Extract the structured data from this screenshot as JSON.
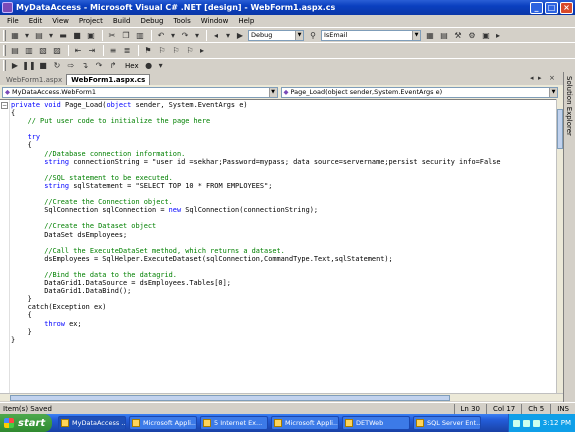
{
  "window": {
    "title": "MyDataAccess - Microsoft Visual C# .NET [design] - WebForm1.aspx.cs"
  },
  "menu": [
    "File",
    "Edit",
    "View",
    "Project",
    "Build",
    "Debug",
    "Tools",
    "Window",
    "Help"
  ],
  "toolbar": {
    "config_value": "Debug",
    "find_value": "IsEmail",
    "hex_label": "Hex"
  },
  "tabs": [
    {
      "label": "WebForm1.aspx",
      "active": false
    },
    {
      "label": "WebForm1.aspx.cs",
      "active": true
    }
  ],
  "nav": {
    "class_combo": "MyDataAccess.WebForm1",
    "method_combo": "Page_Load(object sender,System.EventArgs e)"
  },
  "code_lines": [
    [
      [
        "kw",
        "private void "
      ],
      [
        "",
        "Page_Load("
      ],
      [
        "kw",
        "object"
      ],
      [
        "",
        " sender, System.EventArgs e)"
      ]
    ],
    [
      [
        "",
        "{"
      ]
    ],
    [
      [
        "cm",
        "    // Put user code to initialize the page here"
      ]
    ],
    [
      [
        "",
        ""
      ]
    ],
    [
      [
        "kw",
        "    try"
      ]
    ],
    [
      [
        "",
        "    {"
      ]
    ],
    [
      [
        "cm",
        "        //Database connection information."
      ]
    ],
    [
      [
        "kw",
        "        string"
      ],
      [
        "",
        " connectionString = \"user id =sekhar;Password=mypass; data source=servername;persist security info=False"
      ]
    ],
    [
      [
        "",
        ""
      ]
    ],
    [
      [
        "cm",
        "        //SQL statement to be executed."
      ]
    ],
    [
      [
        "kw",
        "        string"
      ],
      [
        "",
        " sqlStatement = \"SELECT TOP 10 * FROM EMPLOYEES\";"
      ]
    ],
    [
      [
        "",
        ""
      ]
    ],
    [
      [
        "cm",
        "        //Create the Connection object."
      ]
    ],
    [
      [
        "",
        "        SqlConnection sqlConnection = "
      ],
      [
        "kw",
        "new"
      ],
      [
        "",
        " SqlConnection(connectionString);"
      ]
    ],
    [
      [
        "",
        ""
      ]
    ],
    [
      [
        "cm",
        "        //Create the Dataset object"
      ]
    ],
    [
      [
        "",
        "        DataSet dsEmployees;"
      ]
    ],
    [
      [
        "",
        ""
      ]
    ],
    [
      [
        "cm",
        "        //Call the ExecuteDataSet method, which returns a dataset."
      ]
    ],
    [
      [
        "",
        "        dsEmployees = SqlHelper.ExecuteDataset(sqlConnection,CommandType.Text,sqlStatement);"
      ]
    ],
    [
      [
        "",
        ""
      ]
    ],
    [
      [
        "cm",
        "        //Bind the data to the datagrid."
      ]
    ],
    [
      [
        "",
        "        DataGrid1.DataSource = dsEmployees.Tables[0];"
      ]
    ],
    [
      [
        "",
        "        DataGrid1.DataBind();"
      ]
    ],
    [
      [
        "",
        "    }"
      ]
    ],
    [
      [
        "",
        "    catch(Exception ex)"
      ]
    ],
    [
      [
        "",
        "    {"
      ]
    ],
    [
      [
        "kw",
        "        throw"
      ],
      [
        "",
        " ex;"
      ]
    ],
    [
      [
        "",
        "    }"
      ]
    ],
    [
      [
        "",
        "}"
      ]
    ]
  ],
  "sidebar": {
    "label": "Solution Explorer"
  },
  "status": {
    "message": "Item(s) Saved",
    "line": "Ln 30",
    "col": "Col 17",
    "ch": "Ch 5",
    "mode": "INS"
  },
  "taskbar": {
    "start": "start",
    "items": [
      {
        "label": "MyDataAccess ...",
        "active": true
      },
      {
        "label": "Microsoft Appli...",
        "active": false
      },
      {
        "label": "5 Internet Ex...",
        "active": false
      },
      {
        "label": "Microsoft Appli...",
        "active": false
      },
      {
        "label": "DETWeb",
        "active": false
      },
      {
        "label": "SQL Server Ent...",
        "active": false
      }
    ],
    "clock": "3:12 PM"
  },
  "colors": {
    "keyword": "#0000ff",
    "comment": "#008000",
    "titlebar": "#0a3fbf"
  }
}
